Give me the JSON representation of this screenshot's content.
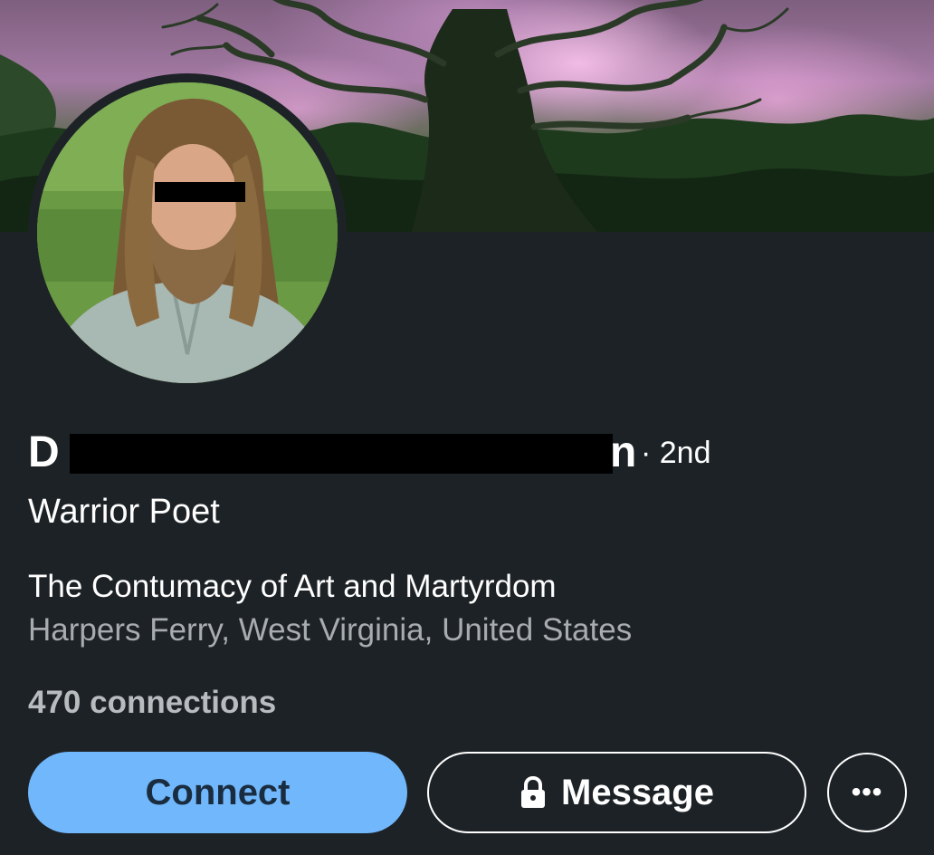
{
  "profile": {
    "name": "D",
    "name_tail": "n",
    "degree": "· 2nd",
    "headline": "Warrior Poet",
    "company": "The Contumacy of Art and Martyrdom",
    "location": "Harpers Ferry, West Virginia, United States",
    "connections": "470 connections"
  },
  "actions": {
    "connect_label": "Connect",
    "message_label": "Message",
    "more_label": "•••"
  },
  "icons": {
    "lock": "lock-icon",
    "more": "more-icon"
  },
  "colors": {
    "background": "#1d2226",
    "connect_button": "#71b7fb",
    "connect_text": "#1a2d40",
    "secondary_text": "#a8acae"
  }
}
